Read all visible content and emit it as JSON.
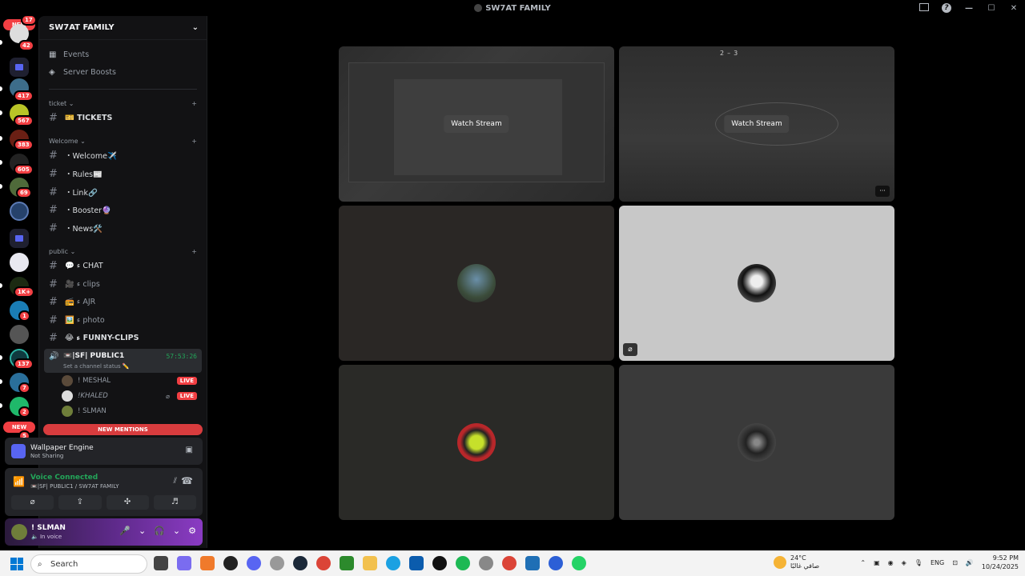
{
  "window": {
    "title": "SW7AT FAMILY",
    "help": "?"
  },
  "guilds": {
    "badges": [
      "17",
      "42",
      "417",
      "567",
      "383",
      "605",
      "69",
      "1K+",
      "1",
      "137",
      "7",
      "2",
      "5"
    ],
    "new_top": "NEW",
    "new_bottom": "NEW"
  },
  "server": {
    "name": "SW7AT FAMILY",
    "menu": [
      {
        "label": "Events",
        "icon": "calendar-icon"
      },
      {
        "label": "Server Boosts",
        "icon": "boost-icon"
      }
    ],
    "categories": {
      "ticket": "ticket ⌄",
      "welcome": "Welcome ⌄",
      "public": "public ⌄"
    },
    "channels_ticket": [
      "🎫 TICKETS"
    ],
    "channels_welcome": [
      "・Welcome✈️",
      "・Rules📰",
      "・Link🔗",
      "・Booster🔮",
      "・News🛠️"
    ],
    "channels_public": [
      "💬 ء CHAT",
      "🎥 ء clips",
      "📻 ء AJR",
      "🖼️ ء photo",
      "😂 ء FUNNY-CLIPS"
    ],
    "voice_channel": {
      "name": "📼|SF| PUBLIC1",
      "time": "57:53:26",
      "status": "Set a channel status ✏️",
      "users": [
        {
          "name": "! MESHAL",
          "live": "LIVE"
        },
        {
          "name": "!KHALED",
          "live": "LIVE"
        },
        {
          "name": "! SLMAN",
          "live": ""
        }
      ]
    },
    "new_mentions": "NEW MENTIONS"
  },
  "activity": {
    "title": "Wallpaper Engine",
    "subtitle": "Not Sharing"
  },
  "voice_status": {
    "title": "Voice Connected",
    "subtitle": "📼|SF| PUBLIC1 / SW7AT FAMILY"
  },
  "user": {
    "name": "! SLMAN",
    "status": "🔈 In voice"
  },
  "stage": {
    "watch_label_1": "Watch Stream",
    "watch_label_2": "Watch Stream",
    "score_left": "2",
    "score_right": "3",
    "score_sep": "–",
    "more": "···"
  },
  "taskbar": {
    "search_placeholder": "Search",
    "weather_temp": "24°C",
    "weather_desc": "صافي غالبًا",
    "lang": "ENG",
    "time": "9:52 PM",
    "date": "10/24/2025"
  }
}
